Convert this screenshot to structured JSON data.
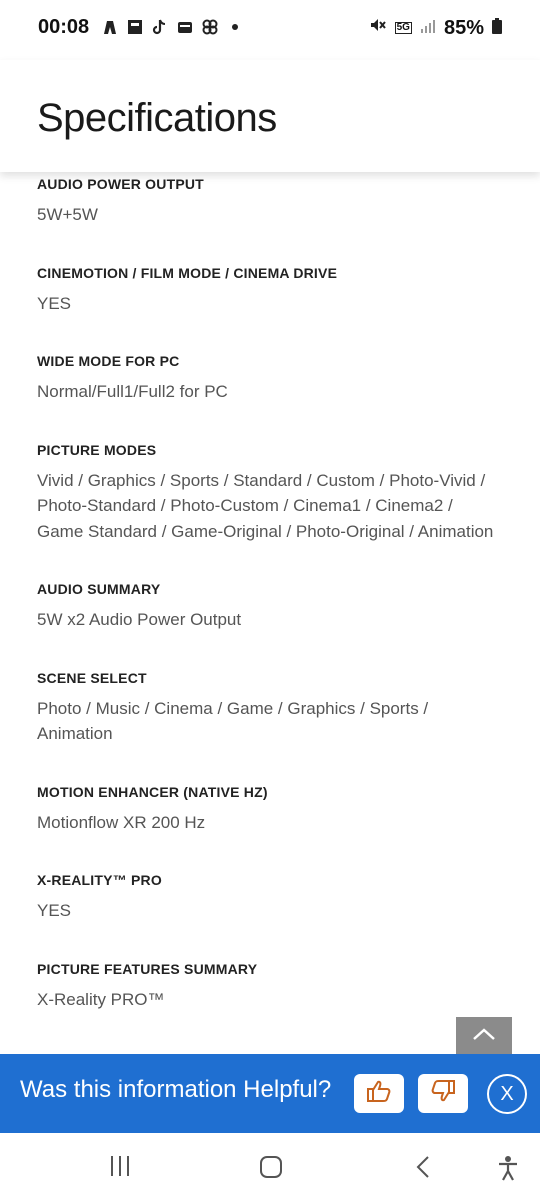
{
  "status_bar": {
    "time": "00:08",
    "battery_percent": "85%",
    "network_label": "5G"
  },
  "header": {
    "title": "Specifications"
  },
  "specs": [
    {
      "label": "AUDIO POWER OUTPUT",
      "value": "5W+5W"
    },
    {
      "label": "CINEMOTION / FILM MODE / CINEMA DRIVE",
      "value": "YES"
    },
    {
      "label": "WIDE MODE FOR PC",
      "value": "Normal/Full1/Full2 for PC"
    },
    {
      "label": "PICTURE MODES",
      "value": "Vivid / Graphics / Sports / Standard / Custom / Photo-Vivid / Photo-Standard / Photo-Custom / Cinema1 / Cinema2 / Game Standard / Game-Original / Photo-Original / Animation"
    },
    {
      "label": "AUDIO SUMMARY",
      "value": "5W x2 Audio Power Output"
    },
    {
      "label": "SCENE SELECT",
      "value": "Photo / Music / Cinema / Game / Graphics / Sports / Animation"
    },
    {
      "label": "MOTION ENHANCER (NATIVE HZ)",
      "value": "Motionflow XR 200 Hz"
    },
    {
      "label": "X-REALITY™ PRO",
      "value": "YES"
    },
    {
      "label": "PICTURE FEATURES SUMMARY",
      "value": "X-Reality PRO™"
    }
  ],
  "feedback": {
    "question": "Was this information Helpful?",
    "close_label": "X"
  },
  "colors": {
    "feedback_bg": "#1f6fd1",
    "icon_accent": "#c8641e"
  }
}
